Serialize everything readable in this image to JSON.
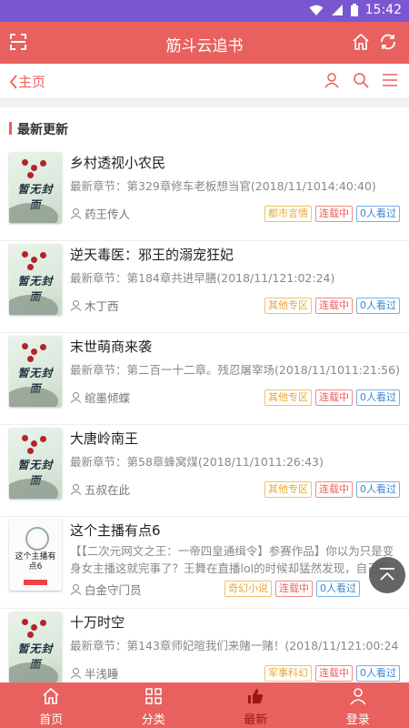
{
  "status_bar": {
    "time": "15:42"
  },
  "app_bar": {
    "title": "筋斗云追书"
  },
  "nav": {
    "back_label": "主页"
  },
  "section": {
    "title": "最新更新"
  },
  "cover_text": "暂无封面",
  "special_cover": {
    "text": "这个主播有点6"
  },
  "books": [
    {
      "title": "乡村透视小农民",
      "latest": "最新章节：第329章修车老板想当官(2018/11/1014:40:40)",
      "author": "药王传人",
      "category": "都市言情",
      "status": "连载中",
      "views": "0人看过"
    },
    {
      "title": "逆天毒医：邪王的溺宠狂妃",
      "latest": "最新章节：第184章共进早膳(2018/11/121:02:24)",
      "author": "木丁西",
      "category": "其他专区",
      "status": "连载中",
      "views": "0人看过"
    },
    {
      "title": "末世萌商来袭",
      "latest": "最新章节：第二百一十二章。残忍屠宰场(2018/11/1011:21:56)",
      "author": "绾墨倾蝶",
      "category": "其他专区",
      "status": "连载中",
      "views": "0人看过"
    },
    {
      "title": "大唐岭南王",
      "latest": "最新章节：第58章蜂窝煤(2018/11/1011:26:43)",
      "author": "五叔在此",
      "category": "其他专区",
      "status": "连载中",
      "views": "0人看过"
    },
    {
      "title": "这个主播有点6",
      "latest": "【【二次元网文之王：一帝四皇通缉令】参赛作品】你以为只是变身女主播这就完事了？王舞在直播lol的时候却猛然发现，自己和别",
      "author": "白金守门员",
      "category": "奇幻小说",
      "status": "连载中",
      "views": "0人看过"
    },
    {
      "title": "十万时空",
      "latest": "最新章节：第143章师妃暄我们来赌一赌！(2018/11/121:00:24)",
      "author": "半浅睡",
      "category": "军事科幻",
      "status": "连载中",
      "views": "0人看过"
    }
  ],
  "tabs": [
    {
      "label": "首页",
      "icon": "home-icon"
    },
    {
      "label": "分类",
      "icon": "grid-icon"
    },
    {
      "label": "最新",
      "icon": "thumb-up-icon",
      "active": true
    },
    {
      "label": "登录",
      "icon": "user-icon"
    }
  ],
  "colors": {
    "accent": "#e8615e",
    "status_bar": "#7a57d1",
    "category_tag": "#e8a830",
    "views_tag": "#3b86d6"
  }
}
